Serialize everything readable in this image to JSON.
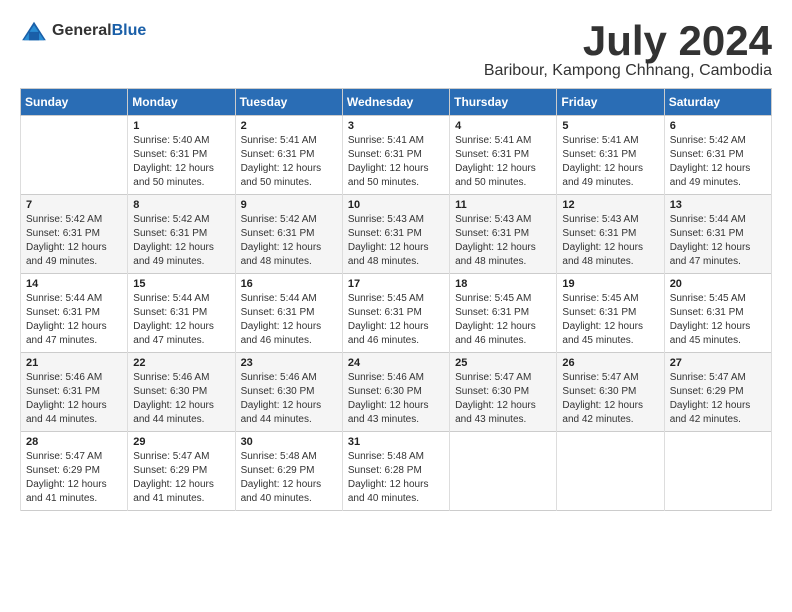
{
  "header": {
    "logo_general": "General",
    "logo_blue": "Blue",
    "month_year": "July 2024",
    "location": "Baribour, Kampong Chhnang, Cambodia"
  },
  "days_of_week": [
    "Sunday",
    "Monday",
    "Tuesday",
    "Wednesday",
    "Thursday",
    "Friday",
    "Saturday"
  ],
  "weeks": [
    [
      {
        "day": "",
        "info": ""
      },
      {
        "day": "1",
        "info": "Sunrise: 5:40 AM\nSunset: 6:31 PM\nDaylight: 12 hours\nand 50 minutes."
      },
      {
        "day": "2",
        "info": "Sunrise: 5:41 AM\nSunset: 6:31 PM\nDaylight: 12 hours\nand 50 minutes."
      },
      {
        "day": "3",
        "info": "Sunrise: 5:41 AM\nSunset: 6:31 PM\nDaylight: 12 hours\nand 50 minutes."
      },
      {
        "day": "4",
        "info": "Sunrise: 5:41 AM\nSunset: 6:31 PM\nDaylight: 12 hours\nand 50 minutes."
      },
      {
        "day": "5",
        "info": "Sunrise: 5:41 AM\nSunset: 6:31 PM\nDaylight: 12 hours\nand 49 minutes."
      },
      {
        "day": "6",
        "info": "Sunrise: 5:42 AM\nSunset: 6:31 PM\nDaylight: 12 hours\nand 49 minutes."
      }
    ],
    [
      {
        "day": "7",
        "info": "Sunrise: 5:42 AM\nSunset: 6:31 PM\nDaylight: 12 hours\nand 49 minutes."
      },
      {
        "day": "8",
        "info": "Sunrise: 5:42 AM\nSunset: 6:31 PM\nDaylight: 12 hours\nand 49 minutes."
      },
      {
        "day": "9",
        "info": "Sunrise: 5:42 AM\nSunset: 6:31 PM\nDaylight: 12 hours\nand 48 minutes."
      },
      {
        "day": "10",
        "info": "Sunrise: 5:43 AM\nSunset: 6:31 PM\nDaylight: 12 hours\nand 48 minutes."
      },
      {
        "day": "11",
        "info": "Sunrise: 5:43 AM\nSunset: 6:31 PM\nDaylight: 12 hours\nand 48 minutes."
      },
      {
        "day": "12",
        "info": "Sunrise: 5:43 AM\nSunset: 6:31 PM\nDaylight: 12 hours\nand 48 minutes."
      },
      {
        "day": "13",
        "info": "Sunrise: 5:44 AM\nSunset: 6:31 PM\nDaylight: 12 hours\nand 47 minutes."
      }
    ],
    [
      {
        "day": "14",
        "info": "Sunrise: 5:44 AM\nSunset: 6:31 PM\nDaylight: 12 hours\nand 47 minutes."
      },
      {
        "day": "15",
        "info": "Sunrise: 5:44 AM\nSunset: 6:31 PM\nDaylight: 12 hours\nand 47 minutes."
      },
      {
        "day": "16",
        "info": "Sunrise: 5:44 AM\nSunset: 6:31 PM\nDaylight: 12 hours\nand 46 minutes."
      },
      {
        "day": "17",
        "info": "Sunrise: 5:45 AM\nSunset: 6:31 PM\nDaylight: 12 hours\nand 46 minutes."
      },
      {
        "day": "18",
        "info": "Sunrise: 5:45 AM\nSunset: 6:31 PM\nDaylight: 12 hours\nand 46 minutes."
      },
      {
        "day": "19",
        "info": "Sunrise: 5:45 AM\nSunset: 6:31 PM\nDaylight: 12 hours\nand 45 minutes."
      },
      {
        "day": "20",
        "info": "Sunrise: 5:45 AM\nSunset: 6:31 PM\nDaylight: 12 hours\nand 45 minutes."
      }
    ],
    [
      {
        "day": "21",
        "info": "Sunrise: 5:46 AM\nSunset: 6:31 PM\nDaylight: 12 hours\nand 44 minutes."
      },
      {
        "day": "22",
        "info": "Sunrise: 5:46 AM\nSunset: 6:30 PM\nDaylight: 12 hours\nand 44 minutes."
      },
      {
        "day": "23",
        "info": "Sunrise: 5:46 AM\nSunset: 6:30 PM\nDaylight: 12 hours\nand 44 minutes."
      },
      {
        "day": "24",
        "info": "Sunrise: 5:46 AM\nSunset: 6:30 PM\nDaylight: 12 hours\nand 43 minutes."
      },
      {
        "day": "25",
        "info": "Sunrise: 5:47 AM\nSunset: 6:30 PM\nDaylight: 12 hours\nand 43 minutes."
      },
      {
        "day": "26",
        "info": "Sunrise: 5:47 AM\nSunset: 6:30 PM\nDaylight: 12 hours\nand 42 minutes."
      },
      {
        "day": "27",
        "info": "Sunrise: 5:47 AM\nSunset: 6:29 PM\nDaylight: 12 hours\nand 42 minutes."
      }
    ],
    [
      {
        "day": "28",
        "info": "Sunrise: 5:47 AM\nSunset: 6:29 PM\nDaylight: 12 hours\nand 41 minutes."
      },
      {
        "day": "29",
        "info": "Sunrise: 5:47 AM\nSunset: 6:29 PM\nDaylight: 12 hours\nand 41 minutes."
      },
      {
        "day": "30",
        "info": "Sunrise: 5:48 AM\nSunset: 6:29 PM\nDaylight: 12 hours\nand 40 minutes."
      },
      {
        "day": "31",
        "info": "Sunrise: 5:48 AM\nSunset: 6:28 PM\nDaylight: 12 hours\nand 40 minutes."
      },
      {
        "day": "",
        "info": ""
      },
      {
        "day": "",
        "info": ""
      },
      {
        "day": "",
        "info": ""
      }
    ]
  ]
}
